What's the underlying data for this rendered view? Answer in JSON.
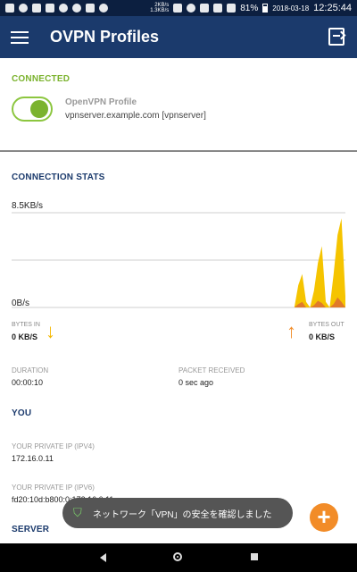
{
  "status_bar": {
    "net_speed_up": "2KB/s",
    "net_speed_down": "1.3KB/s",
    "battery": "81%",
    "date": "2018-03-18",
    "time": "12:25:44"
  },
  "app_bar": {
    "title": "OVPN Profiles",
    "menu_icon": "hamburger-menu-icon",
    "import_icon": "import-profile-icon"
  },
  "connected": {
    "title": "CONNECTED",
    "toggle_on": true,
    "profile_name": "OpenVPN Profile",
    "profile_server": "vpnserver.example.com [vpnserver]"
  },
  "stats": {
    "title": "CONNECTION STATS",
    "chart_top_label": "8.5KB/s",
    "chart_bottom_label": "0B/s",
    "bytes_in_label": "BYTES IN",
    "bytes_in_value": "0 KB/S",
    "bytes_out_label": "BYTES OUT",
    "bytes_out_value": "0 KB/S",
    "duration_label": "DURATION",
    "duration_value": "00:00:10",
    "packet_label": "PACKET RECEIVED",
    "packet_value": "0 sec ago"
  },
  "traffic_samples": {
    "max_kb_per_s": 8.5,
    "in_kb_per_s": [
      0,
      0,
      0,
      0,
      0,
      0,
      0,
      0,
      0,
      0,
      0,
      0,
      0,
      0,
      0,
      0,
      0,
      0,
      0,
      0,
      0,
      0,
      0,
      0,
      0,
      0,
      0,
      0,
      0,
      0,
      0,
      0,
      0,
      0,
      0,
      0,
      0,
      0,
      0,
      0,
      0,
      0,
      0,
      0,
      0,
      0,
      0,
      0,
      0,
      0,
      0,
      0,
      0,
      0,
      0,
      0,
      0,
      0,
      0,
      0,
      0,
      0,
      0,
      0,
      0,
      0,
      0,
      0,
      0,
      0,
      0,
      0,
      0,
      0.3,
      0.5,
      0,
      0,
      0.2,
      0.6,
      0.4,
      0,
      0,
      0.3,
      0.9,
      0.5,
      0
    ],
    "out_kb_per_s": [
      0,
      0,
      0,
      0,
      0,
      0,
      0,
      0,
      0,
      0,
      0,
      0,
      0,
      0,
      0,
      0,
      0,
      0,
      0,
      0,
      0,
      0,
      0,
      0,
      0,
      0,
      0,
      0,
      0,
      0,
      0,
      0,
      0,
      0,
      0,
      0,
      0,
      0,
      0,
      0,
      0,
      0,
      0,
      0,
      0,
      0,
      0,
      0,
      0,
      0,
      0,
      0,
      0,
      0,
      0,
      0,
      0,
      0,
      0,
      0,
      0,
      0,
      0,
      0,
      0,
      0,
      0,
      0,
      0,
      0,
      0,
      0,
      0,
      2.0,
      3.0,
      0.5,
      0,
      1.5,
      4.0,
      5.5,
      0.5,
      0,
      3.0,
      6.5,
      8.0,
      1.0
    ]
  },
  "you": {
    "title": "YOU",
    "ipv4_label": "YOUR PRIVATE IP (IPV4)",
    "ipv4_value": "172.16.0.11",
    "ipv6_label": "YOUR PRIVATE IP (IPV6)",
    "ipv6_value": "fd20:10d:b800:0:172:16:0:11"
  },
  "server": {
    "title": "SERVER"
  },
  "toast": {
    "text": "ネットワーク「VPN」の安全を確認しました"
  },
  "fab": {
    "label": "+"
  },
  "colors": {
    "app_bar": "#1b3a6c",
    "accent_green": "#7bb32e",
    "traffic_out": "#f5c400",
    "traffic_in": "#e07a2a",
    "fab": "#f28c28"
  }
}
